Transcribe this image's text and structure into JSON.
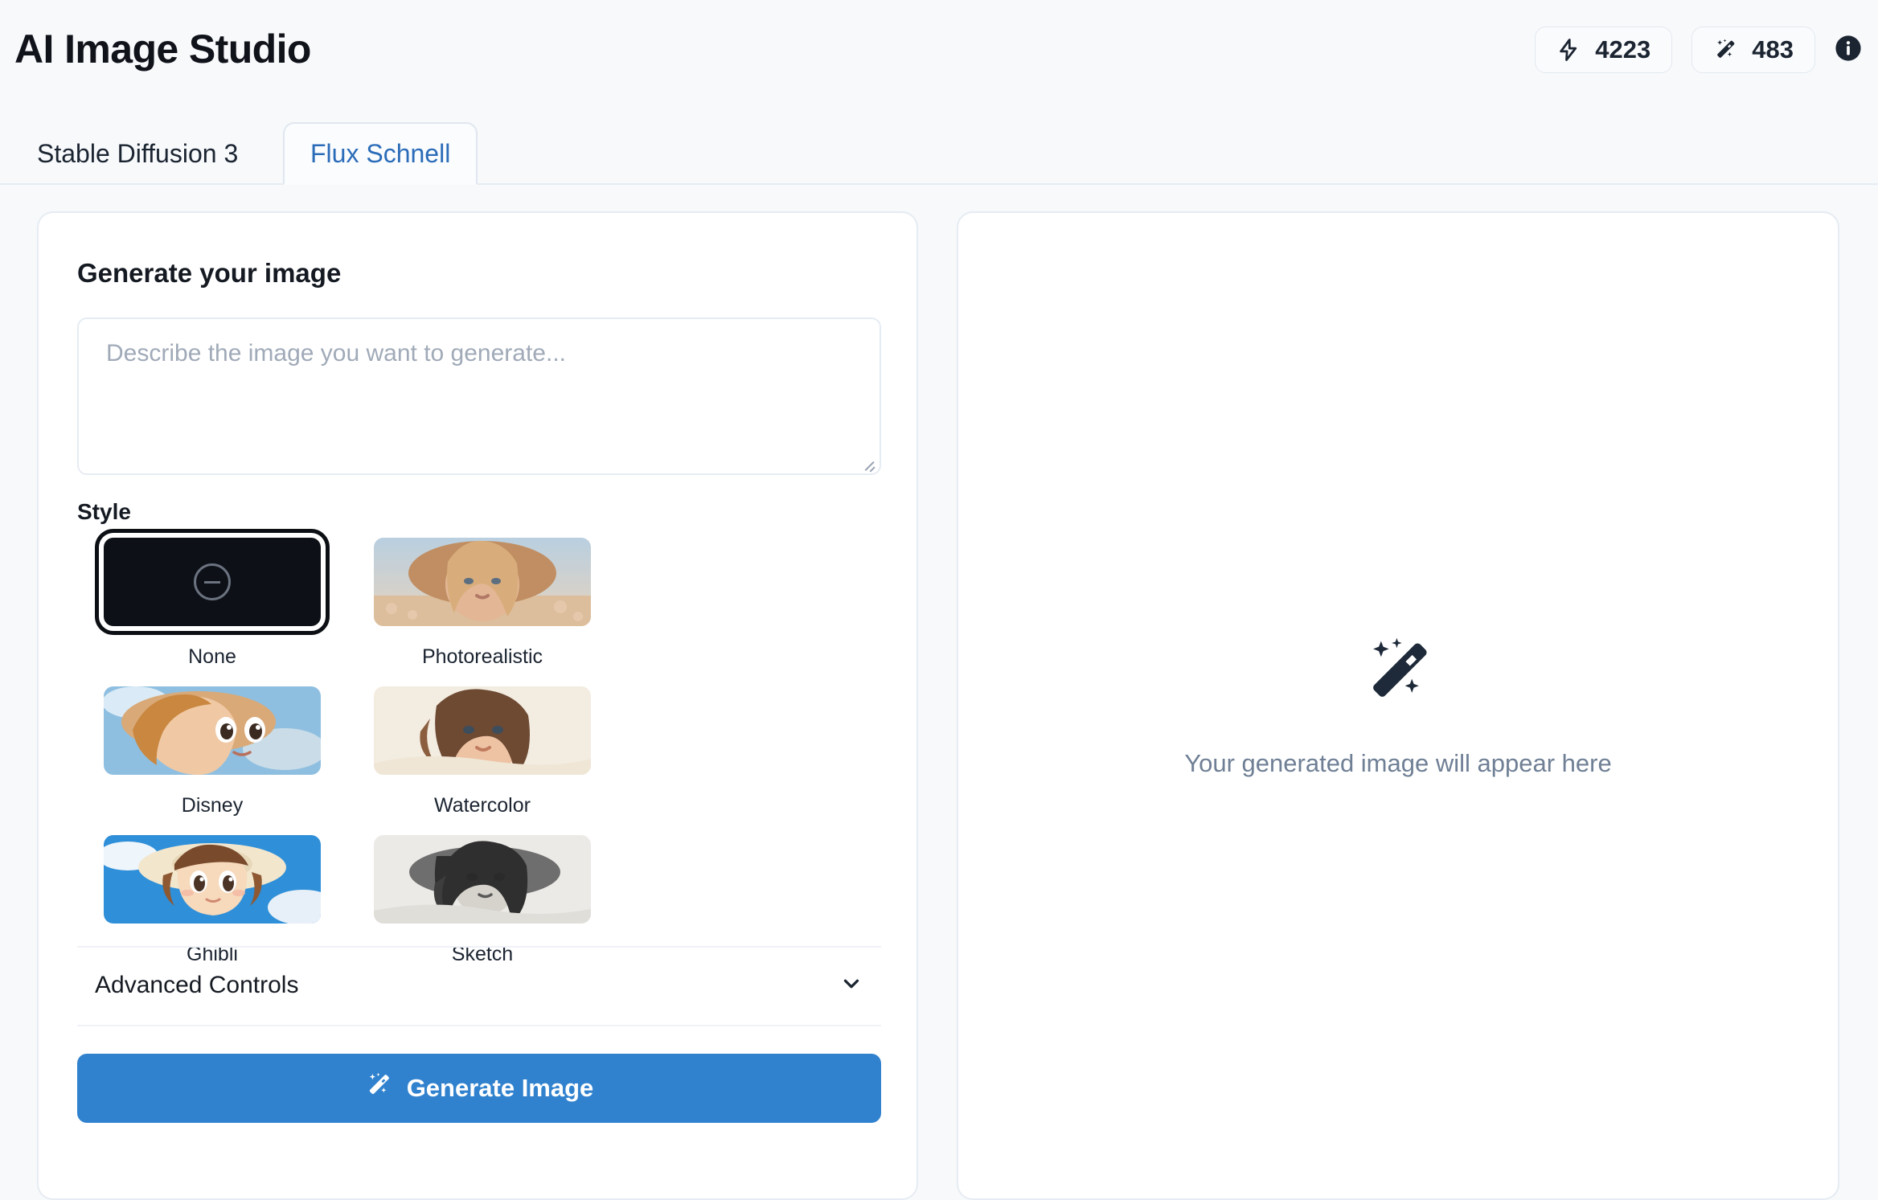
{
  "header": {
    "title": "AI Image Studio",
    "badges": [
      {
        "icon": "lightning-bolt-icon",
        "value": "4223"
      },
      {
        "icon": "magic-wand-icon",
        "value": "483"
      }
    ],
    "info_icon": "info-icon"
  },
  "tabs": [
    {
      "label": "Stable Diffusion 3",
      "active": false
    },
    {
      "label": "Flux Schnell",
      "active": true
    }
  ],
  "left_panel": {
    "heading": "Generate your image",
    "prompt": {
      "value": "",
      "placeholder": "Describe the image you want to generate..."
    },
    "style": {
      "label": "Style",
      "selected": "None",
      "options": [
        {
          "name": "None",
          "thumb": "none"
        },
        {
          "name": "Photorealistic",
          "thumb": "photorealistic"
        },
        {
          "name": "Disney",
          "thumb": "disney"
        },
        {
          "name": "Watercolor",
          "thumb": "watercolor"
        },
        {
          "name": "Ghibli",
          "thumb": "ghibli"
        },
        {
          "name": "Sketch",
          "thumb": "sketch"
        }
      ]
    },
    "advanced": {
      "label": "Advanced Controls",
      "icon": "chevron-down-icon",
      "expanded": false
    },
    "generate_button": {
      "label": "Generate Image",
      "icon": "magic-wand-icon"
    }
  },
  "right_panel": {
    "placeholder_text": "Your generated image will appear here",
    "placeholder_icon": "magic-wand-icon"
  },
  "colors": {
    "page_background": "#f7f9fb",
    "card_background": "#ffffff",
    "card_border": "#e6ecf3",
    "accent_blue": "#3182ce",
    "tab_active_text": "#2b6cb8",
    "muted_text": "#6f7f95",
    "placeholder_text": "#a0aab8",
    "dark_text": "#151a22"
  }
}
